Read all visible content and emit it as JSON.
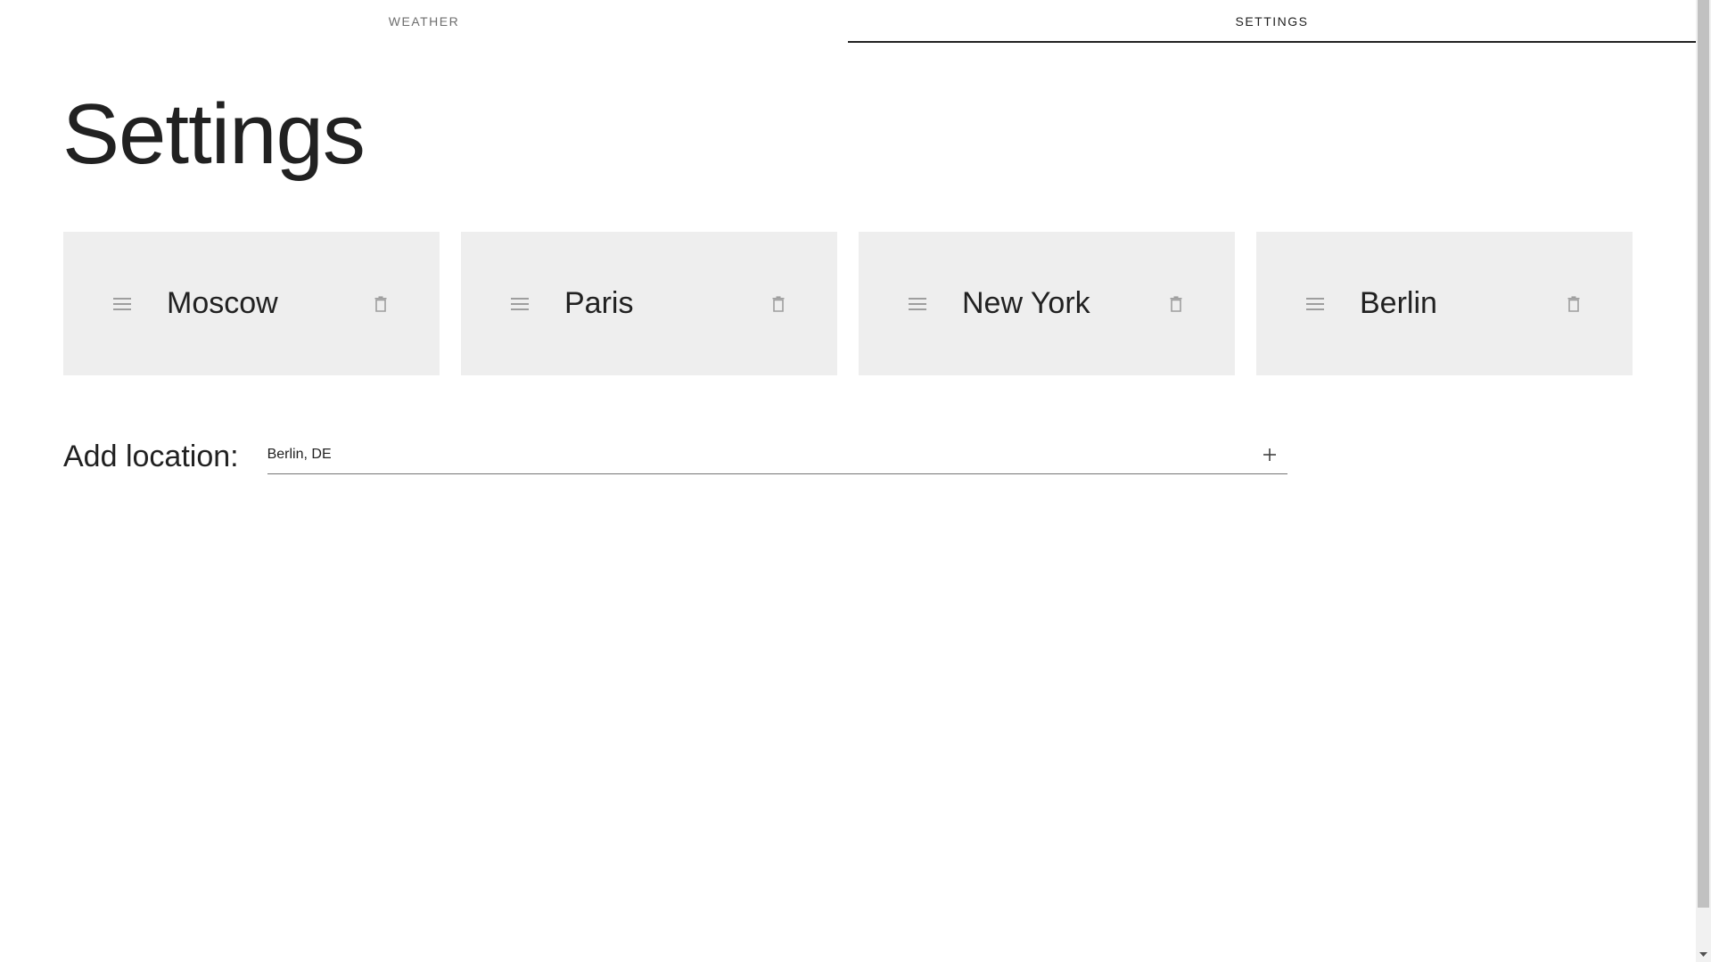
{
  "tabs": [
    {
      "label": "WEATHER",
      "active": false
    },
    {
      "label": "SETTINGS",
      "active": true
    }
  ],
  "page_title": "Settings",
  "locations": [
    {
      "name": "Moscow"
    },
    {
      "name": "Paris"
    },
    {
      "name": "New York"
    },
    {
      "name": "Berlin"
    }
  ],
  "add_location": {
    "label": "Add location:",
    "value": "Berlin, DE"
  },
  "icons": {
    "drag": "drag-handle-icon",
    "delete": "trash-icon",
    "add": "plus-icon"
  },
  "colors": {
    "card_background": "#eeeeee",
    "tab_indicator": "#212121",
    "text": "#212121"
  }
}
